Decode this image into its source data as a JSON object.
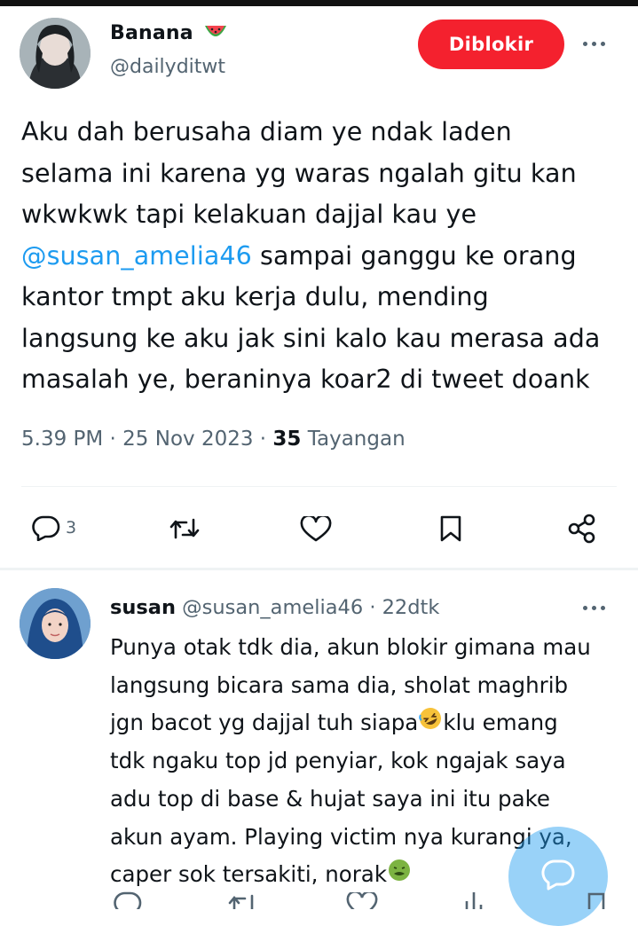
{
  "tweet": {
    "author_name": "Banana",
    "author_handle": "@dailyditwt",
    "blocked_label": "Diblokir",
    "text_lines": [
      "Aku dah berusaha diam ye ndak laden",
      "selama ini karena yg waras ngalah gitu kan",
      "wkwkwk tapi kelakuan dajjal kau ye",
      "sampai ganggu ke orang",
      "kantor tmpt aku kerja dulu, mending",
      "langsung ke aku jak sini kalo kau merasa ada",
      "masalah ye, beraninya koar2 di tweet doank"
    ],
    "mention": "@susan_amelia46",
    "time": "5.39 PM · 25 Nov 2023 ·",
    "views_count": "35",
    "views_label": "Tayangan",
    "reply_count": "3"
  },
  "reply": {
    "name": "susan",
    "handle": "@susan_amelia46",
    "time": "· 22dtk",
    "text_lines": [
      "Punya otak tdk dia, akun blokir gimana mau",
      "langsung bicara sama dia, sholat maghrib",
      "jgn bacot yg dajjal tuh siapa",
      "klu emang",
      "tdk ngaku top jd penyiar, kok ngajak saya",
      "adu top di base & hujat saya ini itu pake",
      "akun ayam. Playing victim nya kurangi ya,",
      "caper sok tersakiti, norak"
    ]
  },
  "icons": {
    "title_emoji": "watermelon-icon",
    "reply": "reply-icon",
    "retweet": "retweet-icon",
    "like": "heart-icon",
    "bookmark": "bookmark-icon",
    "share": "share-icon",
    "views": "views-icon",
    "compose": "compose-icon",
    "laugh_emoji": "rofl-emoji-icon",
    "sick_emoji": "nauseated-emoji-icon"
  },
  "colors": {
    "blocked": "#f4212e",
    "link": "#1d9bf0",
    "secondary_text": "#536471",
    "fab": "#1d9bf0"
  }
}
